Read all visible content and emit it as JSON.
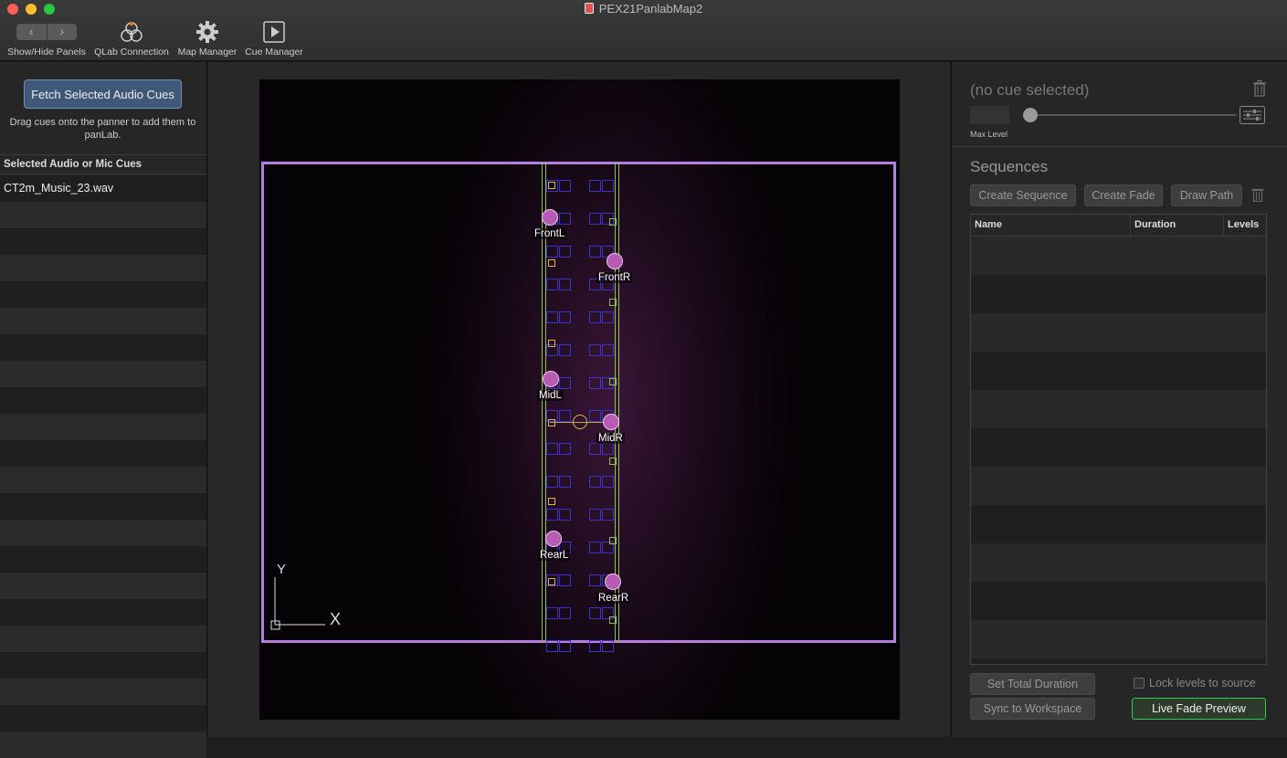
{
  "window": {
    "title": "PEX21PanlabMap2"
  },
  "toolbar": {
    "panels_label": "Show/Hide Panels",
    "qlab_label": "QLab Connection",
    "map_label": "Map Manager",
    "cue_label": "Cue Manager"
  },
  "left": {
    "fetch_button": "Fetch Selected Audio Cues",
    "hint": "Drag cues onto the panner to add them to panLab.",
    "list_header": "Selected Audio or Mic Cues",
    "cues": [
      "CT2m_Music_23.wav"
    ]
  },
  "canvas": {
    "speakers": [
      "FrontL",
      "FrontR",
      "MidL",
      "MidR",
      "RearL",
      "RearR"
    ],
    "axis": {
      "y": "Y",
      "x": "X"
    },
    "colors": {
      "stage_border": "#b57ee0",
      "speaker_dot": "#b75bb5",
      "rail": "#8bc34a",
      "seat": "#3a33c8"
    }
  },
  "right": {
    "cue_title": "(no cue selected)",
    "max_level_label": "Max Level",
    "sequences_title": "Sequences",
    "create_sequence": "Create Sequence",
    "create_fade": "Create Fade",
    "draw_path": "Draw Path",
    "table_headers": [
      "Name",
      "Duration",
      "Levels"
    ],
    "set_total_duration": "Set Total Duration",
    "sync_to_workspace": "Sync to Workspace",
    "lock_levels": "Lock levels to source",
    "live_fade_preview": "Live Fade Preview",
    "accent": "#2ecc40"
  }
}
